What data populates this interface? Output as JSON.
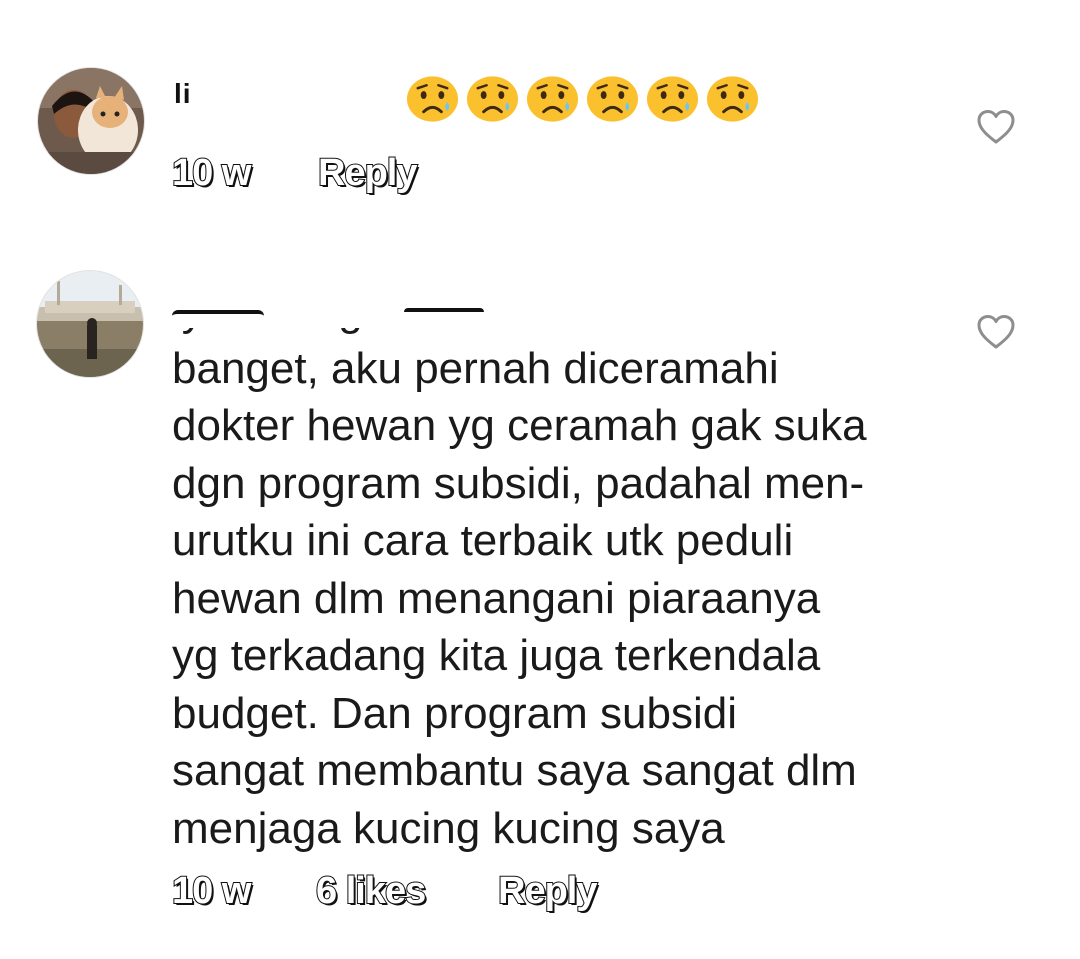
{
  "comments": [
    {
      "username": "li",
      "text": "",
      "emoji_name": "sad-tear-face",
      "emoji_count": 6,
      "time": "10 w",
      "likes": "",
      "reply_label": "Reply"
    },
    {
      "username": "",
      "text": "lya mb ngerti\nbanget,  aku pernah diceramahi\ndokter hewan yg ceramah gak suka\ndgn program subsidi, padahal men-\nurutku ini cara terbaik utk peduli\nhewan dlm menangani piaraanya\nyg terkadang kita juga terkendala\nbudget. Dan program subsidi\nsangat membantu saya sangat dlm\nmenjaga kucing kucing saya",
      "time": "10 w",
      "likes": "6 likes",
      "reply_label": "Reply"
    }
  ],
  "icons": {
    "like": "heart-outline-icon",
    "emoji": "sad-face-with-tear-icon"
  },
  "colors": {
    "background": "#ffffff",
    "text": "#1a1a1a",
    "icon": "#8e8e8e",
    "emoji": "#fbc02d"
  }
}
